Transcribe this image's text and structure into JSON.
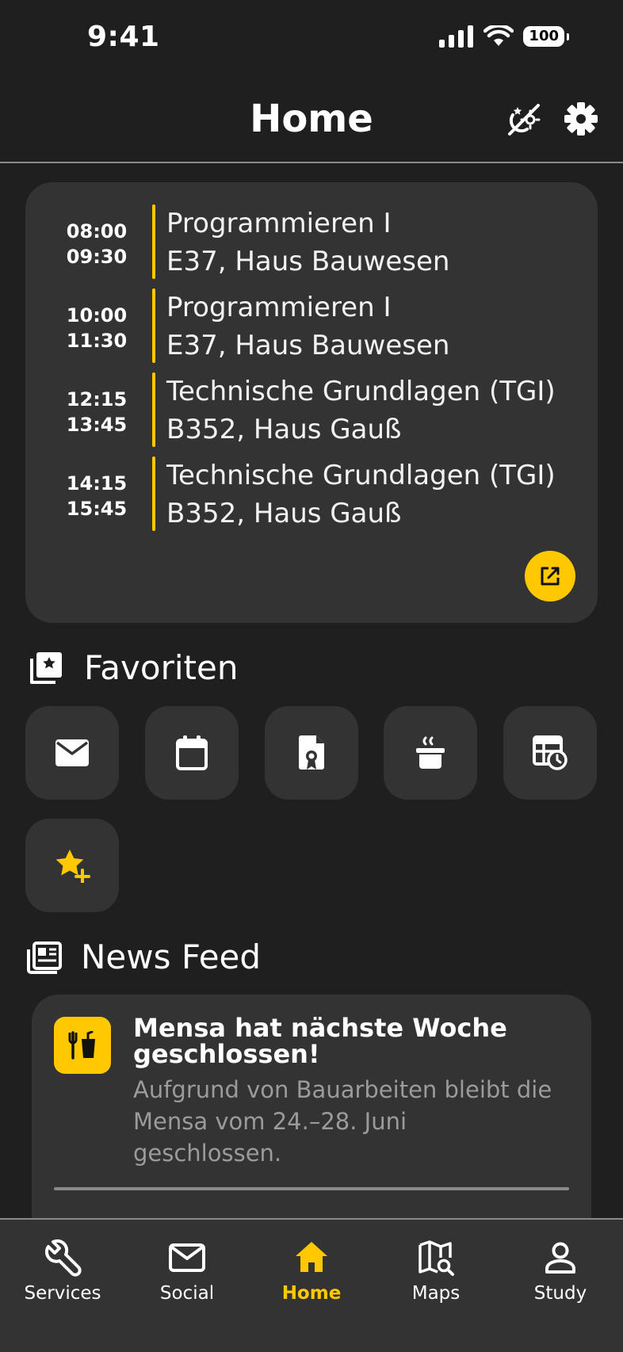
{
  "status_bar": {
    "time": "9:41",
    "battery": "100"
  },
  "header": {
    "title": "Home",
    "theme_icon": "theme-toggle-icon",
    "settings_icon": "gear-icon"
  },
  "schedule": {
    "items": [
      {
        "start": "08:00",
        "end": "09:30",
        "title": "Programmieren I",
        "room": "E37, Haus Bauwesen"
      },
      {
        "start": "10:00",
        "end": "11:30",
        "title": "Programmieren I",
        "room": "E37, Haus Bauwesen"
      },
      {
        "start": "12:15",
        "end": "13:45",
        "title": "Technische Grundlagen (TGI)",
        "room": "B352, Haus Gauß"
      },
      {
        "start": "14:15",
        "end": "15:45",
        "title": "Technische Grundlagen (TGI)",
        "room": "B352, Haus Gauß"
      }
    ],
    "open_icon": "open-external-icon",
    "accent": "#ffc800"
  },
  "favorites": {
    "title": "Favoriten",
    "items": [
      "mail-icon",
      "calendar-icon",
      "grade-document-icon",
      "canteen-pot-icon",
      "timetable-clock-icon",
      "add-favorite-star-icon"
    ]
  },
  "news": {
    "title": "News Feed",
    "items": [
      {
        "icon": "restaurant-icon",
        "title": "Mensa hat nächste Woche geschlossen!",
        "body": "Aufgrund von Bauarbeiten bleibt die Mensa vom 24.–28. Juni geschlossen."
      }
    ]
  },
  "nav": {
    "items": [
      {
        "label": "Services",
        "icon": "wrench-icon"
      },
      {
        "label": "Social",
        "icon": "mail-icon"
      },
      {
        "label": "Home",
        "icon": "home-icon",
        "active": true
      },
      {
        "label": "Maps",
        "icon": "map-search-icon"
      },
      {
        "label": "Study",
        "icon": "person-icon"
      }
    ]
  },
  "colors": {
    "background": "#1f1f1f",
    "card": "#333333",
    "accent": "#ffc800",
    "muted_text": "#9b9b9b"
  }
}
